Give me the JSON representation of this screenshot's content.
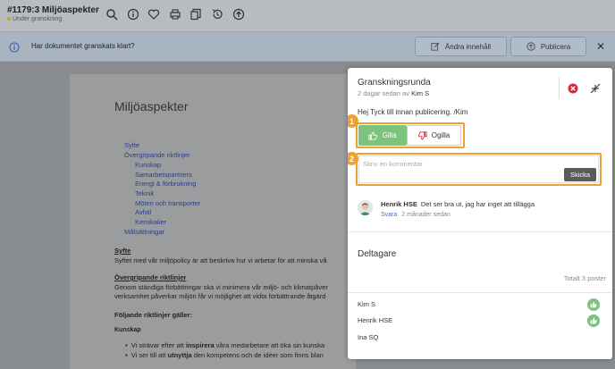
{
  "header": {
    "title": "#1179:3 Miljöaspekter",
    "status": "Under granskning",
    "icons": [
      "search-icon",
      "info-icon",
      "heart-icon",
      "print-icon",
      "copy-icon",
      "history-icon",
      "upload-icon"
    ]
  },
  "notice": {
    "text": "Har dokumentet granskats klart?",
    "edit_label": "Ändra innehåll",
    "publish_label": "Publicera",
    "close": "✕"
  },
  "document": {
    "title": "Miljöaspekter",
    "toc": [
      {
        "text": "Syfte",
        "level": 0
      },
      {
        "text": "Övergripande riktlinjer",
        "level": 0
      },
      {
        "text": "Kunskap",
        "level": 1
      },
      {
        "text": "Samarbetspartners",
        "level": 1
      },
      {
        "text": "Energi & förbrukning",
        "level": 1
      },
      {
        "text": "Teknik",
        "level": 1
      },
      {
        "text": "Möten och transporter",
        "level": 1
      },
      {
        "text": "Avfall",
        "level": 1
      },
      {
        "text": "Kemikalier",
        "level": 1
      },
      {
        "text": "Målsättningar",
        "level": 0
      }
    ],
    "section1_heading": "Syfte",
    "section1_text": "Syftet med vår miljöpolicy är att beskriva hur vi arbetar för att minska vå",
    "section2_heading": "Övergripande riktlinjer",
    "section2_line1": "Genom ständiga förbättringar ska vi minimera vår miljö- och klimatpåver",
    "section2_line2": "verksamhet påverkar miljön får vi möjlighet att vidta förbättrande åtgärd",
    "rules_heading": "Följande riktlinjer gäller:",
    "sub_heading": "Kunskap",
    "bullet1_a": "Vi strävar efter att ",
    "bullet1_b": "inspirera",
    "bullet1_c": " våra medarbetare att öka sin kunska",
    "bullet2_a": "Vi ser till att ",
    "bullet2_b": "utnyttja",
    "bullet2_c": " den kompetens och de idéer som finns blan"
  },
  "review": {
    "title": "Granskningsrunda",
    "subtitle_prefix": "2 dagar sedan av",
    "subtitle_author": "Kim S",
    "message": "Hej Tyck till innan publicering. /Kim",
    "like_label": "Gilla",
    "dislike_label": "Ogilla",
    "comment_placeholder": "Skriv en kommentar",
    "send_label": "Skicka",
    "badge1": "1",
    "badge2": "2",
    "comment": {
      "author": "Henrik HSE",
      "text": "Det ser bra ut, jag har inget att tillägga",
      "reply": "Svara",
      "time": "2 månader sedan"
    },
    "participants_title": "Deltagare",
    "total": "Totalt 3 poster",
    "participants": [
      {
        "name": "Kim S",
        "liked": true
      },
      {
        "name": "Henrik HSE",
        "liked": true
      },
      {
        "name": "Ina SQ",
        "liked": false
      }
    ]
  },
  "colors": {
    "accent": "#f0a030",
    "like": "#7cc47d",
    "link": "#3a6fd8",
    "danger": "#d9263a"
  }
}
